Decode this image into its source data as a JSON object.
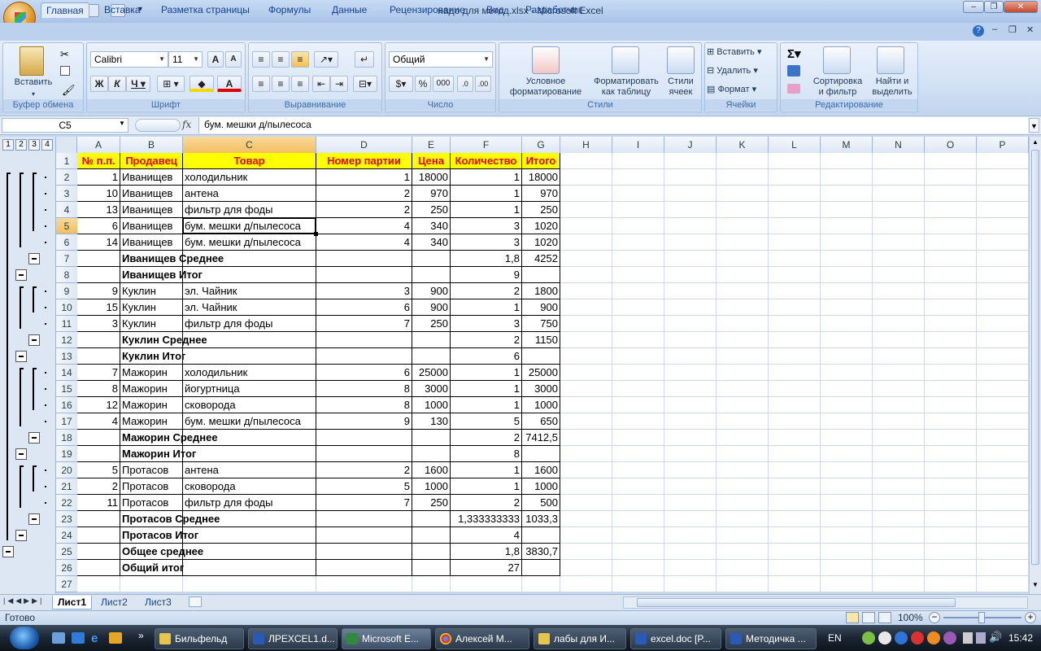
{
  "window": {
    "title": "надо для метод.xlsx - Microsoft Excel"
  },
  "ribbon": {
    "tabs": [
      "Главная",
      "Вставка",
      "Разметка страницы",
      "Формулы",
      "Данные",
      "Рецензирование",
      "Вид",
      "Разработчик"
    ],
    "clipboard": {
      "paste": "Вставить",
      "label": "Буфер обмена"
    },
    "font": {
      "name": "Calibri",
      "size": "11",
      "label": "Шрифт"
    },
    "alignment": {
      "label": "Выравнивание"
    },
    "number": {
      "format": "Общий",
      "label": "Число"
    },
    "styles": {
      "cond1": "Условное",
      "cond2": "форматирование",
      "table1": "Форматировать",
      "table2": "как таблицу",
      "style1": "Стили",
      "style2": "ячеек",
      "label": "Стили"
    },
    "cells": {
      "insert": "Вставить",
      "delete": "Удалить",
      "format": "Формат",
      "label": "Ячейки"
    },
    "editing": {
      "sort1": "Сортировка",
      "sort2": "и фильтр",
      "find1": "Найти и",
      "find2": "выделить",
      "label": "Редактирование"
    }
  },
  "formula_bar": {
    "name_box": "C5",
    "fx": "fx",
    "formula": "бум. мешки д/пылесоса"
  },
  "outline_levels": [
    "1",
    "2",
    "3",
    "4"
  ],
  "columns": [
    "A",
    "B",
    "C",
    "D",
    "E",
    "F",
    "G",
    "H",
    "I",
    "J",
    "K",
    "L",
    "M",
    "N",
    "O",
    "P"
  ],
  "rows": [
    "1",
    "2",
    "3",
    "4",
    "5",
    "6",
    "7",
    "8",
    "9",
    "10",
    "11",
    "12",
    "13",
    "14",
    "15",
    "16",
    "17",
    "18",
    "19",
    "20",
    "21",
    "22",
    "23",
    "24",
    "25",
    "26",
    "27"
  ],
  "table": {
    "headers": [
      "№ п.п.",
      "Продавец",
      "Товар",
      "Номер партии",
      "Цена",
      "Количество",
      "Итого"
    ],
    "data": [
      [
        "1",
        "Иванищев",
        "холодильник",
        "1",
        "18000",
        "1",
        "18000"
      ],
      [
        "10",
        "Иванищев",
        "антена",
        "2",
        "970",
        "1",
        "970"
      ],
      [
        "13",
        "Иванищев",
        "фильтр для фоды",
        "2",
        "250",
        "1",
        "250"
      ],
      [
        "6",
        "Иванищев",
        "бум. мешки д/пылесоса",
        "4",
        "340",
        "3",
        "1020"
      ],
      [
        "14",
        "Иванищев",
        "бум. мешки д/пылесоса",
        "4",
        "340",
        "3",
        "1020"
      ],
      [
        "",
        "Иванищев Среднее",
        "",
        "",
        "",
        "1,8",
        "4252"
      ],
      [
        "",
        "Иванищев Итог",
        "",
        "",
        "",
        "9",
        ""
      ],
      [
        "9",
        "Куклин",
        "эл. Чайник",
        "3",
        "900",
        "2",
        "1800"
      ],
      [
        "15",
        "Куклин",
        "эл. Чайник",
        "6",
        "900",
        "1",
        "900"
      ],
      [
        "3",
        "Куклин",
        "фильтр для фоды",
        "7",
        "250",
        "3",
        "750"
      ],
      [
        "",
        "Куклин Среднее",
        "",
        "",
        "",
        "2",
        "1150"
      ],
      [
        "",
        "Куклин Итог",
        "",
        "",
        "",
        "6",
        ""
      ],
      [
        "7",
        "Мажорин",
        "холодильник",
        "6",
        "25000",
        "1",
        "25000"
      ],
      [
        "8",
        "Мажорин",
        "йогуртница",
        "8",
        "3000",
        "1",
        "3000"
      ],
      [
        "12",
        "Мажорин",
        "сковорода",
        "8",
        "1000",
        "1",
        "1000"
      ],
      [
        "4",
        "Мажорин",
        "бум. мешки д/пылесоса",
        "9",
        "130",
        "5",
        "650"
      ],
      [
        "",
        "Мажорин Среднее",
        "",
        "",
        "",
        "2",
        "7412,5"
      ],
      [
        "",
        "Мажорин Итог",
        "",
        "",
        "",
        "8",
        ""
      ],
      [
        "5",
        "Протасов",
        "антена",
        "2",
        "1600",
        "1",
        "1600"
      ],
      [
        "2",
        "Протасов",
        "сковорода",
        "5",
        "1000",
        "1",
        "1000"
      ],
      [
        "11",
        "Протасов",
        "фильтр для фоды",
        "7",
        "250",
        "2",
        "500"
      ],
      [
        "",
        "Протасов Среднее",
        "",
        "",
        "",
        "1,333333333",
        "1033,3"
      ],
      [
        "",
        "Протасов Итог",
        "",
        "",
        "",
        "4",
        ""
      ],
      [
        "",
        "Общее среднее",
        "",
        "",
        "",
        "1,8",
        "3830,7"
      ],
      [
        "",
        "Общий итог",
        "",
        "",
        "",
        "27",
        ""
      ]
    ]
  },
  "sheets": [
    "Лист1",
    "Лист2",
    "Лист3"
  ],
  "status": {
    "ready": "Готово",
    "zoom": "100%"
  },
  "taskbar": {
    "items": [
      "Бильфельд",
      "ЛРEXCEL1.d...",
      "Microsoft E...",
      "Алексей М...",
      "лабы для И...",
      "excel.doc [P...",
      "Методичка ..."
    ],
    "lang": "EN",
    "time": "15:42"
  }
}
